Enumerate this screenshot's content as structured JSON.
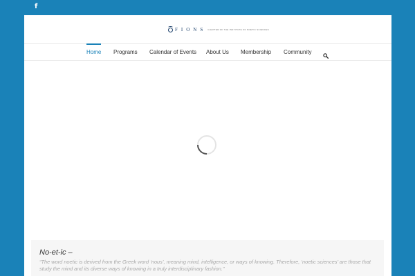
{
  "social": {
    "facebook_glyph": "f",
    "icon": "facebook-icon"
  },
  "logo": {
    "wordmark": "FIONS",
    "subtitle": "CHAPTER OF THE INSTITUTE OF NOETIC SCIENCES"
  },
  "nav": {
    "items": [
      {
        "label": "Home",
        "active": true
      },
      {
        "label": "Programs",
        "active": false
      },
      {
        "label": "Calendar of Events",
        "active": false
      },
      {
        "label": "About Us",
        "active": false
      },
      {
        "label": "Membership",
        "active": false
      },
      {
        "label": "Community",
        "active": false
      }
    ],
    "search_icon": "search-icon"
  },
  "loader": {
    "icon": "loading-spinner-icon"
  },
  "quote": {
    "title": "No-et-ic –",
    "text": "“The word noetic is derived from the Greek word ‘nous’, meaning mind, intelligence, or ways of knowing. Therefore, ‘noetic sciences’ are those that study the mind and its diverse ways of knowing in a truly interdisciplinary fashion.”"
  },
  "colors": {
    "brand_blue": "#1a82b8",
    "logo_navy": "#1b3f6a",
    "text_dark": "#333333",
    "quote_text": "#a8a8a8",
    "quote_bg": "#f6f6f6"
  }
}
